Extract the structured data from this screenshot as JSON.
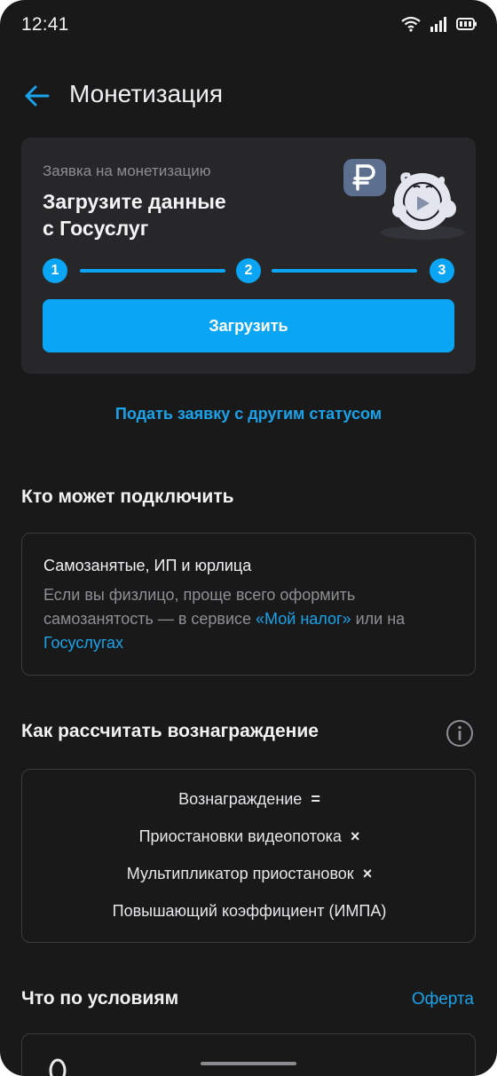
{
  "status_bar": {
    "time": "12:41"
  },
  "header": {
    "title": "Монетизация"
  },
  "status_card": {
    "caption": "Заявка на монетизацию",
    "headline_line1": "Загрузите данные",
    "headline_line2": "с Госуслуг",
    "steps": [
      "1",
      "2",
      "3"
    ],
    "button_label": "Загрузить",
    "accent": "#0aa6f5"
  },
  "other_status_link": "Подать заявку с другим статусом",
  "who_section": {
    "title": "Кто может подключить",
    "box_title": "Самозанятые, ИП и юрлица",
    "text_part1": "Если вы физлицо, проще всего оформить самозанятость — в сервисе ",
    "link1": "«Мой налог»",
    "text_part2": " или на ",
    "link2": "Госуслугах"
  },
  "calc_section": {
    "title": "Как рассчитать вознаграждение",
    "formula": [
      {
        "text": "Вознаграждение",
        "op": "="
      },
      {
        "text": "Приостановки видеопотока",
        "op": "×"
      },
      {
        "text": "Мультипликатор приостановок",
        "op": "×"
      },
      {
        "text": "Повышающий коэффициент (ИМПА)",
        "op": ""
      }
    ]
  },
  "terms_section": {
    "title": "Что по условиям",
    "link": "Оферта"
  }
}
